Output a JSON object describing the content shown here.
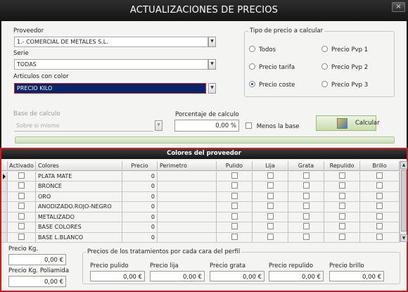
{
  "window": {
    "title": "ACTUALIZACIONES DE PRECIOS",
    "close": "×"
  },
  "form": {
    "proveedor": {
      "label": "Proveedor",
      "value": "1.- COMERCIAL DE METALES S.L."
    },
    "serie": {
      "label": "Serie",
      "value": "TODAS"
    },
    "articulos": {
      "label": "Articulos con color",
      "value": "PRECIO KILO"
    },
    "base": {
      "label": "Base de calculo",
      "value": "Sobre si mismo"
    },
    "porcentaje": {
      "label": "Porcentaje de calculo",
      "value": "0,00 %"
    },
    "menos_base": {
      "label": "Menos la base",
      "checked": false
    },
    "calcular": {
      "label": "Calcular"
    }
  },
  "tipo_precio": {
    "title": "Tipo de precio a calcular",
    "options": [
      {
        "label": "Todos",
        "selected": false
      },
      {
        "label": "Precio Pvp 1",
        "selected": false
      },
      {
        "label": "Precio tarifa",
        "selected": false
      },
      {
        "label": "Precio Pvp 2",
        "selected": false
      },
      {
        "label": "Precio coste",
        "selected": true
      },
      {
        "label": "Precio Pvp 3",
        "selected": false
      }
    ]
  },
  "grid": {
    "title": "Colores del proveedor",
    "columns": [
      "Activado",
      "Colores",
      "Precio",
      "Perimetro",
      "Pulido",
      "Lija",
      "Grata",
      "Repulido",
      "Brillo"
    ],
    "rows": [
      {
        "activado": false,
        "color": "PLATA MATE",
        "precio": "0",
        "perimetro": "",
        "pulido": false,
        "lija": false,
        "grata": false,
        "repulido": false,
        "brillo": false
      },
      {
        "activado": false,
        "color": "BRONCE",
        "precio": "0",
        "perimetro": "",
        "pulido": false,
        "lija": false,
        "grata": false,
        "repulido": false,
        "brillo": false
      },
      {
        "activado": false,
        "color": "ORO",
        "precio": "0",
        "perimetro": "",
        "pulido": false,
        "lija": false,
        "grata": false,
        "repulido": false,
        "brillo": false
      },
      {
        "activado": false,
        "color": "ANODIZADO.ROJO-NEGRO",
        "precio": "0",
        "perimetro": "",
        "pulido": false,
        "lija": false,
        "grata": false,
        "repulido": false,
        "brillo": false
      },
      {
        "activado": false,
        "color": "METALIZADO",
        "precio": "0",
        "perimetro": "",
        "pulido": false,
        "lija": false,
        "grata": false,
        "repulido": false,
        "brillo": false
      },
      {
        "activado": false,
        "color": "BASE COLORES",
        "precio": "0",
        "perimetro": "",
        "pulido": false,
        "lija": false,
        "grata": false,
        "repulido": false,
        "brillo": false
      },
      {
        "activado": false,
        "color": "BASE L.BLANCO",
        "precio": "0",
        "perimetro": "",
        "pulido": false,
        "lija": false,
        "grata": false,
        "repulido": false,
        "brillo": false
      }
    ]
  },
  "bottom": {
    "precio_kg": {
      "label": "Precio Kg.",
      "value": "0,00 €"
    },
    "precio_kg_poliamida": {
      "label": "Precio Kg. Poliamida",
      "value": "0,00 €"
    },
    "tratamientos": {
      "title": "Precios de los tratamientos por cada cara del perfil",
      "items": [
        {
          "label": "Precio pulido",
          "value": "0,00 €"
        },
        {
          "label": "Precio lija",
          "value": "0,00 €"
        },
        {
          "label": "Precio grata",
          "value": "0,00 €"
        },
        {
          "label": "Precio repulido",
          "value": "0,00 €"
        },
        {
          "label": "Precio brillo",
          "value": "0,00 €"
        }
      ]
    }
  }
}
